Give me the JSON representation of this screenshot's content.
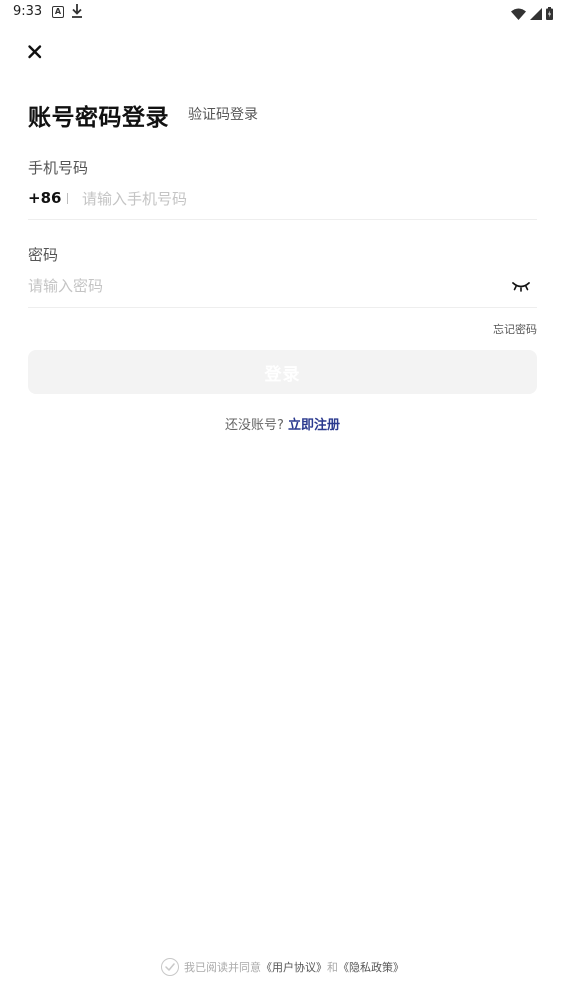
{
  "status_bar": {
    "time": "9:33",
    "icons": [
      "a-notification-icon",
      "download-icon",
      "wifi-icon",
      "signal-icon",
      "battery-icon"
    ]
  },
  "header": {
    "close_icon": "close-icon",
    "title": "账号密码登录",
    "alt_login": "验证码登录"
  },
  "phone": {
    "label": "手机号码",
    "country_code": "+86",
    "separator": "|",
    "placeholder": "请输入手机号码",
    "value": ""
  },
  "password": {
    "label": "密码",
    "placeholder": "请输入密码",
    "value": "",
    "toggle_icon": "eye-closed-icon"
  },
  "forgot_password": "忘记密码",
  "login_button": "登录",
  "register": {
    "question": "还没账号?",
    "link": "立即注册"
  },
  "agreement": {
    "prefix": "我已阅读并同意",
    "user_agreement": "《用户协议》",
    "conjunction": "和",
    "privacy_policy": "《隐私政策》",
    "checked": false
  },
  "colors": {
    "primary_link": "#2b3a8f",
    "button_disabled_bg": "#f3f3f3",
    "placeholder": "#c4c4c4",
    "divider": "#eeeeee"
  }
}
